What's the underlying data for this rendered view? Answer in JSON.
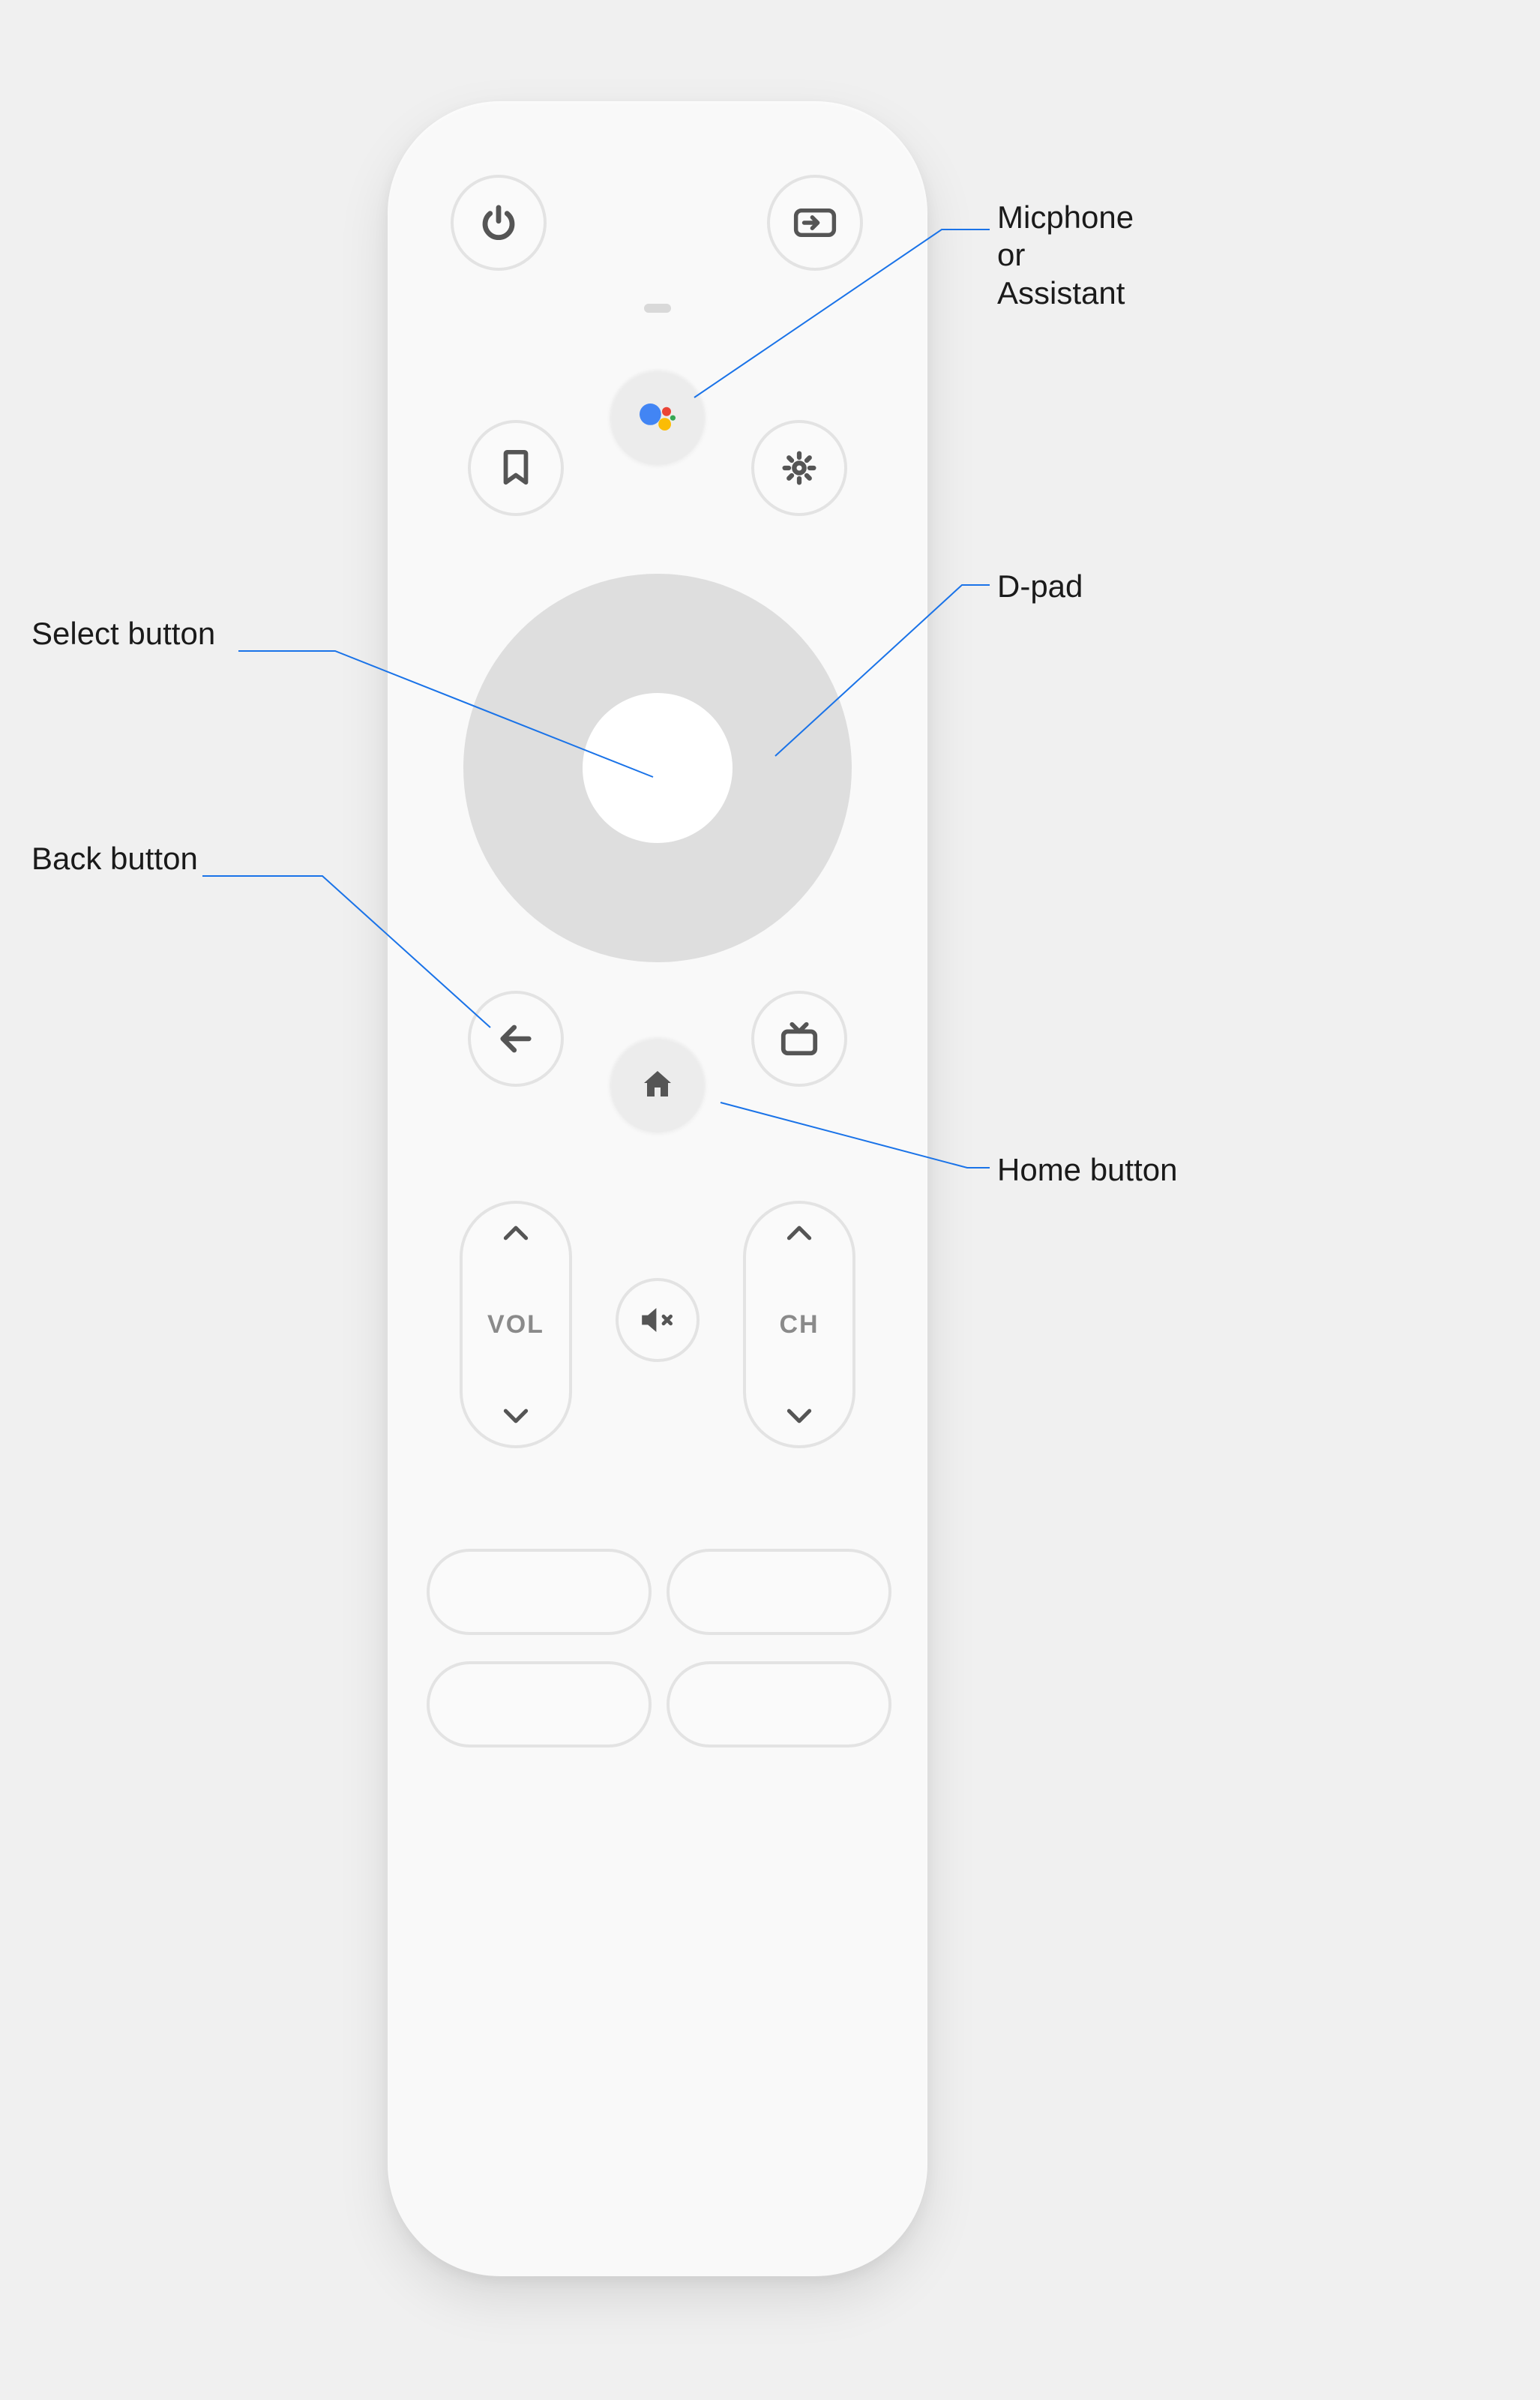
{
  "labels": {
    "mic": "Micphone\nor\nAssistant",
    "dpad": "D-pad",
    "select": "Select button",
    "back": "Back button",
    "home": "Home button"
  },
  "rockers": {
    "vol": "VOL",
    "ch": "CH"
  },
  "icons": {
    "power": "power-icon",
    "input": "input-source-icon",
    "assistant": "google-assistant-icon",
    "bookmark": "bookmark-icon",
    "settings": "settings-gear-icon",
    "back": "back-arrow-icon",
    "home": "home-icon",
    "tv": "live-tv-icon",
    "mute": "mute-icon",
    "chev_up": "chevron-up-icon",
    "chev_dn": "chevron-down-icon"
  },
  "assistant_colors": {
    "blue": "#4285F4",
    "red": "#EA4335",
    "yellow": "#FBBC05",
    "green": "#34A853"
  },
  "leader_color": "#1A73E8"
}
